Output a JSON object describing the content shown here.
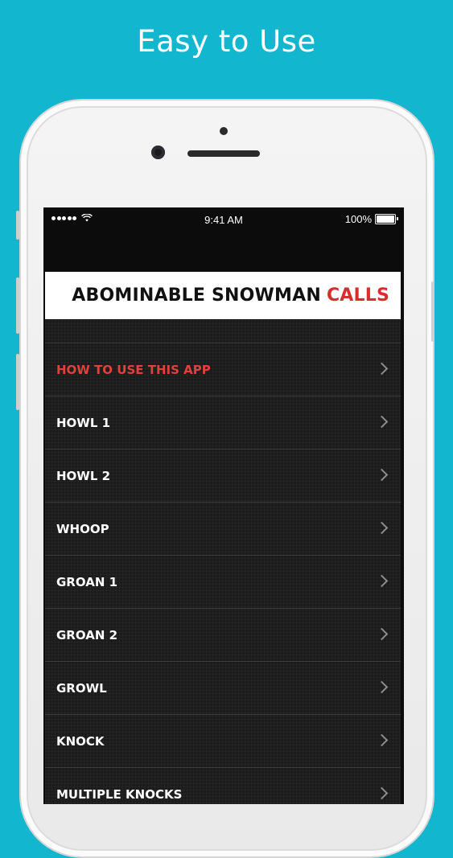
{
  "promo": {
    "title": "Easy to Use"
  },
  "status_bar": {
    "time": "9:41 AM",
    "battery": "100%"
  },
  "banner": {
    "title_main": "ABOMINABLE SNOWMAN",
    "title_accent": "CALLS"
  },
  "menu": {
    "items": [
      {
        "label": "HOW TO USE THIS APP",
        "highlight": true
      },
      {
        "label": "HOWL 1"
      },
      {
        "label": "HOWL 2"
      },
      {
        "label": "WHOOP"
      },
      {
        "label": "GROAN 1"
      },
      {
        "label": "GROAN 2"
      },
      {
        "label": "GROWL"
      },
      {
        "label": "KNOCK"
      },
      {
        "label": "MULTIPLE KNOCKS"
      }
    ]
  },
  "colors": {
    "background": "#13b6cf",
    "accent_red": "#d62d2d",
    "list_bg": "#1b1b1b"
  },
  "icons": [
    "wifi-icon",
    "battery-icon",
    "chevron-right-icon"
  ]
}
